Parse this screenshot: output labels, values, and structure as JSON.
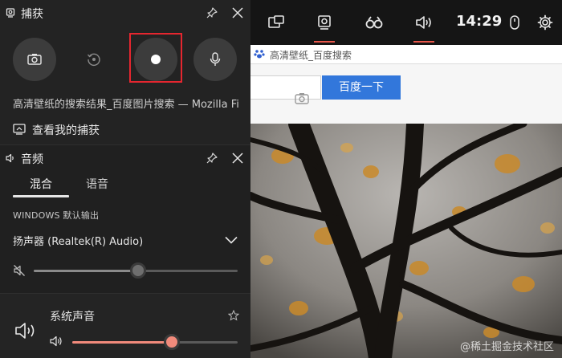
{
  "capture": {
    "title": "捕获",
    "window_title": "高清壁纸的搜索结果_百度图片搜索 — Mozilla Firefox",
    "view_captures_label": "查看我的捕获"
  },
  "audio": {
    "title": "音频",
    "tabs": [
      {
        "label": "混合",
        "selected": true
      },
      {
        "label": "语音",
        "selected": false
      }
    ],
    "output_label": "WINDOWS 默认输出",
    "device_name": "扬声器 (Realtek(R) Audio)",
    "master_volume": 0.51,
    "master_muted": true,
    "app": {
      "name": "系统声音",
      "volume": 0.6
    }
  },
  "gamebar": {
    "clock": "14:29"
  },
  "browser": {
    "tab_text": "高清壁纸_百度搜索",
    "search_button": "百度一下",
    "watermark": "@稀土掘金技术社区"
  },
  "colors": {
    "accent": "#e8564a",
    "record_highlight": "#e5262f",
    "app_slider": "#f18a7b",
    "search_button": "#3277db"
  }
}
